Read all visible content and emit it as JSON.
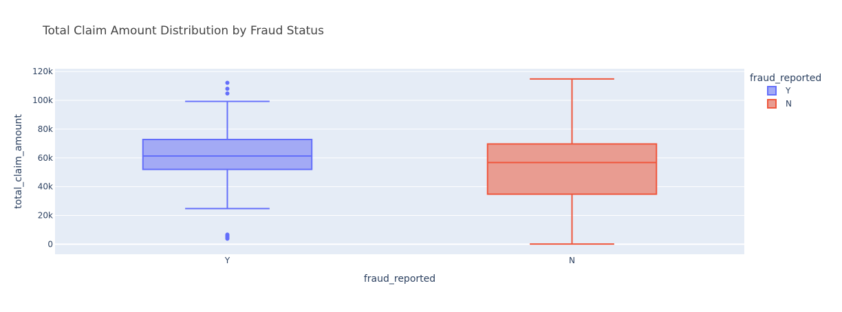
{
  "chart_data": {
    "type": "box",
    "title": "Total Claim Amount Distribution by Fraud Status",
    "xlabel": "fraud_reported",
    "ylabel": "total_claim_amount",
    "categories": [
      "Y",
      "N"
    ],
    "ylim": [
      -7000,
      122000
    ],
    "yticks": [
      0,
      20000,
      40000,
      60000,
      80000,
      100000,
      120000
    ],
    "ytick_labels": [
      "0",
      "20k",
      "40k",
      "60k",
      "80k",
      "100k",
      "120k"
    ],
    "grid": true,
    "legend": {
      "title": "fraud_reported",
      "placement": "top-right",
      "entries": [
        "Y",
        "N"
      ]
    },
    "series": [
      {
        "name": "Y",
        "color": "#636efa",
        "fill": "#a3aaf5",
        "whisker_low": 24800,
        "q1": 52000,
        "median": 61300,
        "q3": 72800,
        "whisker_high": 99300,
        "outliers": [
          112200,
          108100,
          104800,
          6700,
          6200,
          5800,
          5300,
          4800,
          4300,
          3800
        ]
      },
      {
        "name": "N",
        "color": "#ef553b",
        "fill": "#e99c91",
        "whisker_low": 100,
        "q1": 34800,
        "median": 56800,
        "q3": 69700,
        "whisker_high": 114900,
        "outliers": []
      }
    ]
  }
}
